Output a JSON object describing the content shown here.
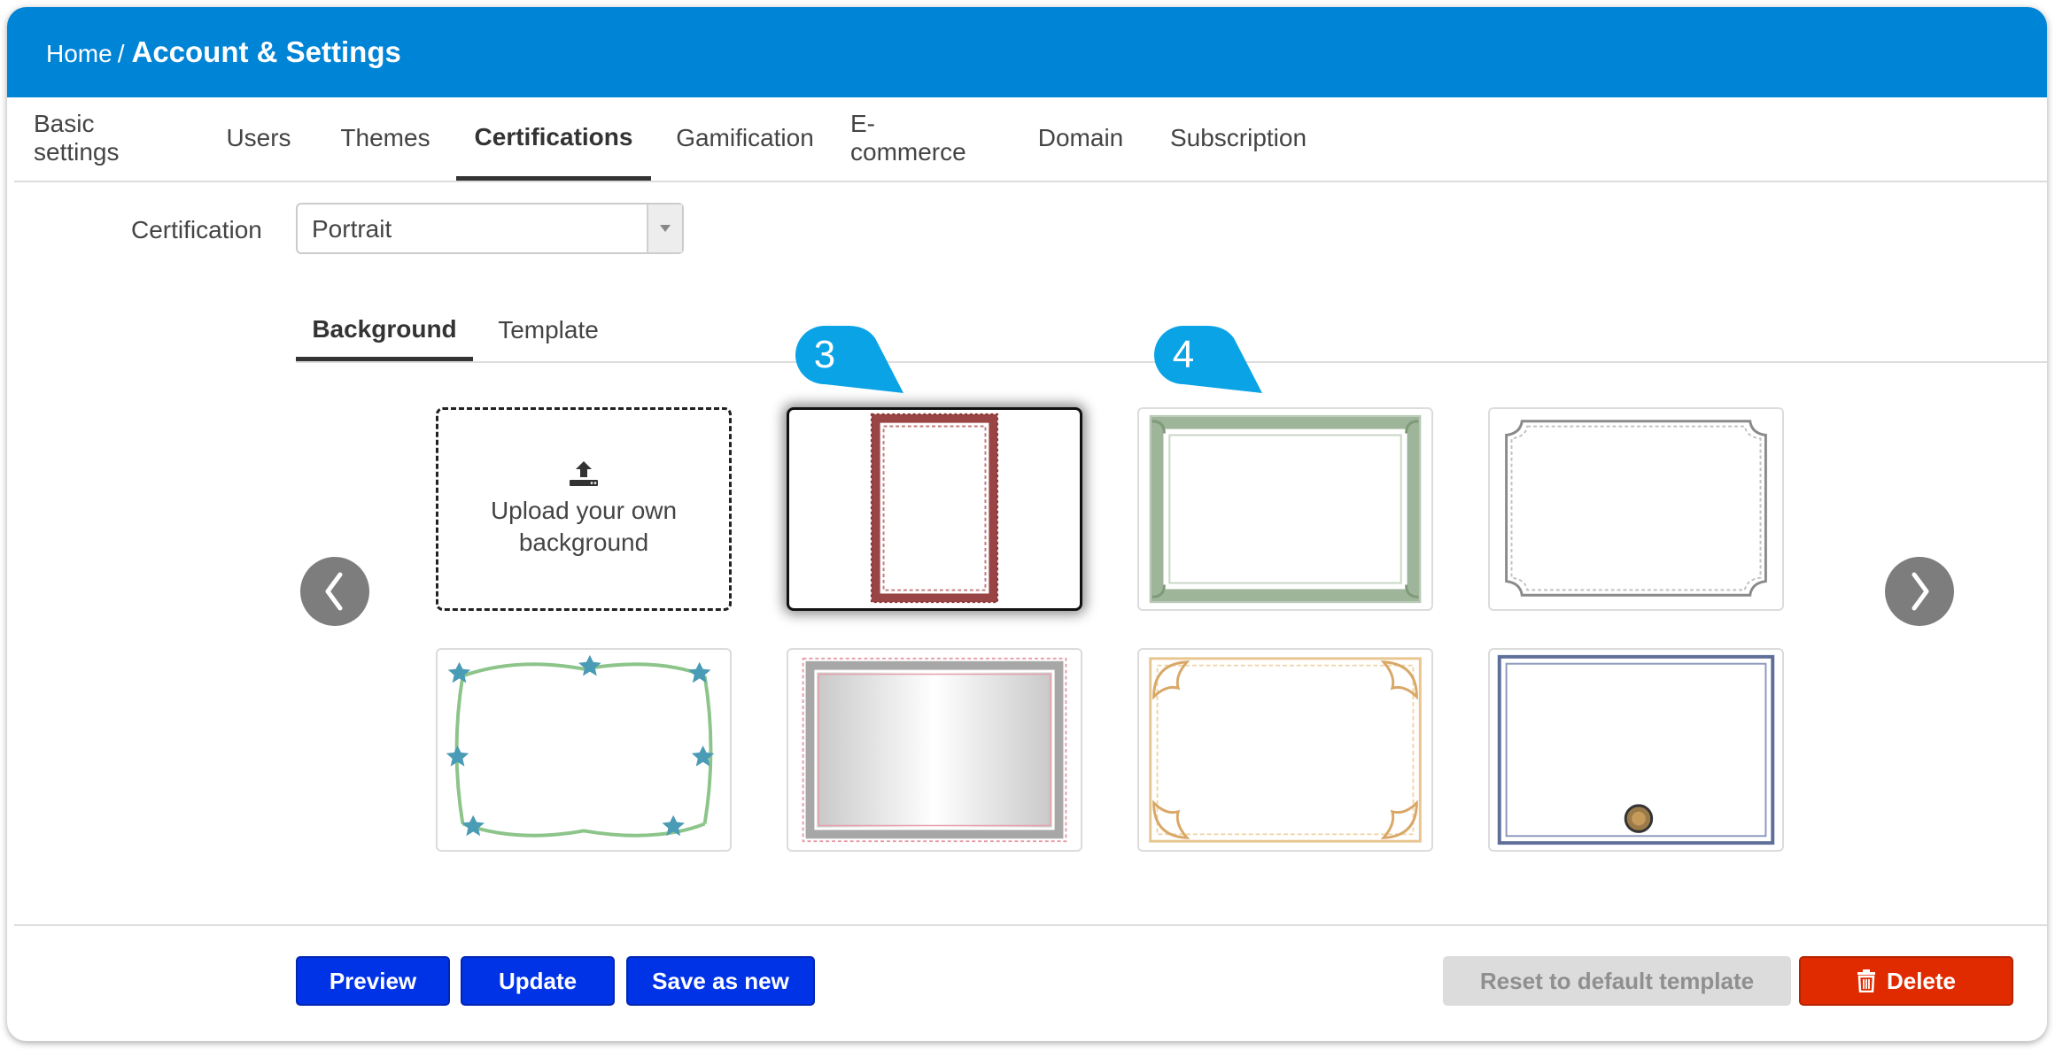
{
  "header": {
    "breadcrumb_home": "Home",
    "breadcrumb_separator": "/",
    "breadcrumb_current": "Account & Settings"
  },
  "main_tabs": [
    {
      "label": "Basic settings"
    },
    {
      "label": "Users"
    },
    {
      "label": "Themes"
    },
    {
      "label": "Certifications",
      "active": true
    },
    {
      "label": "Gamification"
    },
    {
      "label": "E-commerce"
    },
    {
      "label": "Domain"
    },
    {
      "label": "Subscription"
    }
  ],
  "certification": {
    "label": "Certification",
    "selected_value": "Portrait"
  },
  "sub_tabs": [
    {
      "label": "Background",
      "active": true
    },
    {
      "label": "Template"
    }
  ],
  "callouts": [
    "3",
    "4"
  ],
  "gallery": {
    "upload_label": "Upload your own background",
    "selected_index": 1,
    "icons": {
      "prev": "chevron-left-icon",
      "next": "chevron-right-icon",
      "upload": "upload-icon"
    }
  },
  "footer": {
    "preview_label": "Preview",
    "update_label": "Update",
    "save_as_new_label": "Save as new",
    "reset_label": "Reset to default template",
    "delete_label": "Delete"
  },
  "colors": {
    "header": "#0084d6",
    "callout": "#0aa3e6",
    "primary_button": "#0033e6",
    "delete_button": "#e02a00",
    "disabled_button": "#dcdcdc"
  }
}
